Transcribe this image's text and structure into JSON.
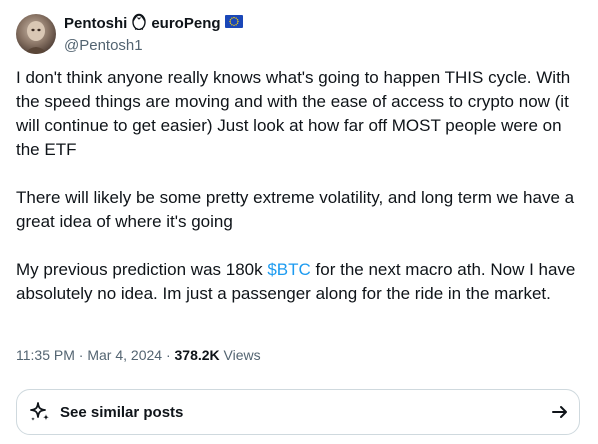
{
  "author": {
    "name_part1": "Pentoshi",
    "name_part2": "euroPeng",
    "handle": "@Pentosh1",
    "icons": [
      "penguin-icon",
      "eu-flag-icon"
    ],
    "avatar": "avatar-image"
  },
  "post": {
    "paragraphs": [
      "I don't think anyone really knows what's going to happen THIS cycle. With the speed things are moving and with the ease of access to crypto now (it will continue to get easier) Just look at how far off MOST people were on the ETF",
      "There will likely be some pretty extreme volatility, and long term we have a great idea of where it's going"
    ],
    "last_paragraph": {
      "before": "My previous prediction was 180k ",
      "cashtag": "$BTC",
      "after": " for the next macro ath. Now I have absolutely no idea. Im just a passenger along for the ride in the market."
    }
  },
  "meta": {
    "time": "11:35 PM",
    "separator": " · ",
    "date": "Mar 4, 2024",
    "views_count": "378.2K",
    "views_label": " Views"
  },
  "similar": {
    "label": "See similar posts",
    "icons": [
      "sparkle-icon",
      "arrow-right-icon"
    ]
  },
  "colors": {
    "link": "#1d9bf0",
    "text": "#0f1419",
    "secondary": "#536471",
    "border": "#cfd9de"
  }
}
